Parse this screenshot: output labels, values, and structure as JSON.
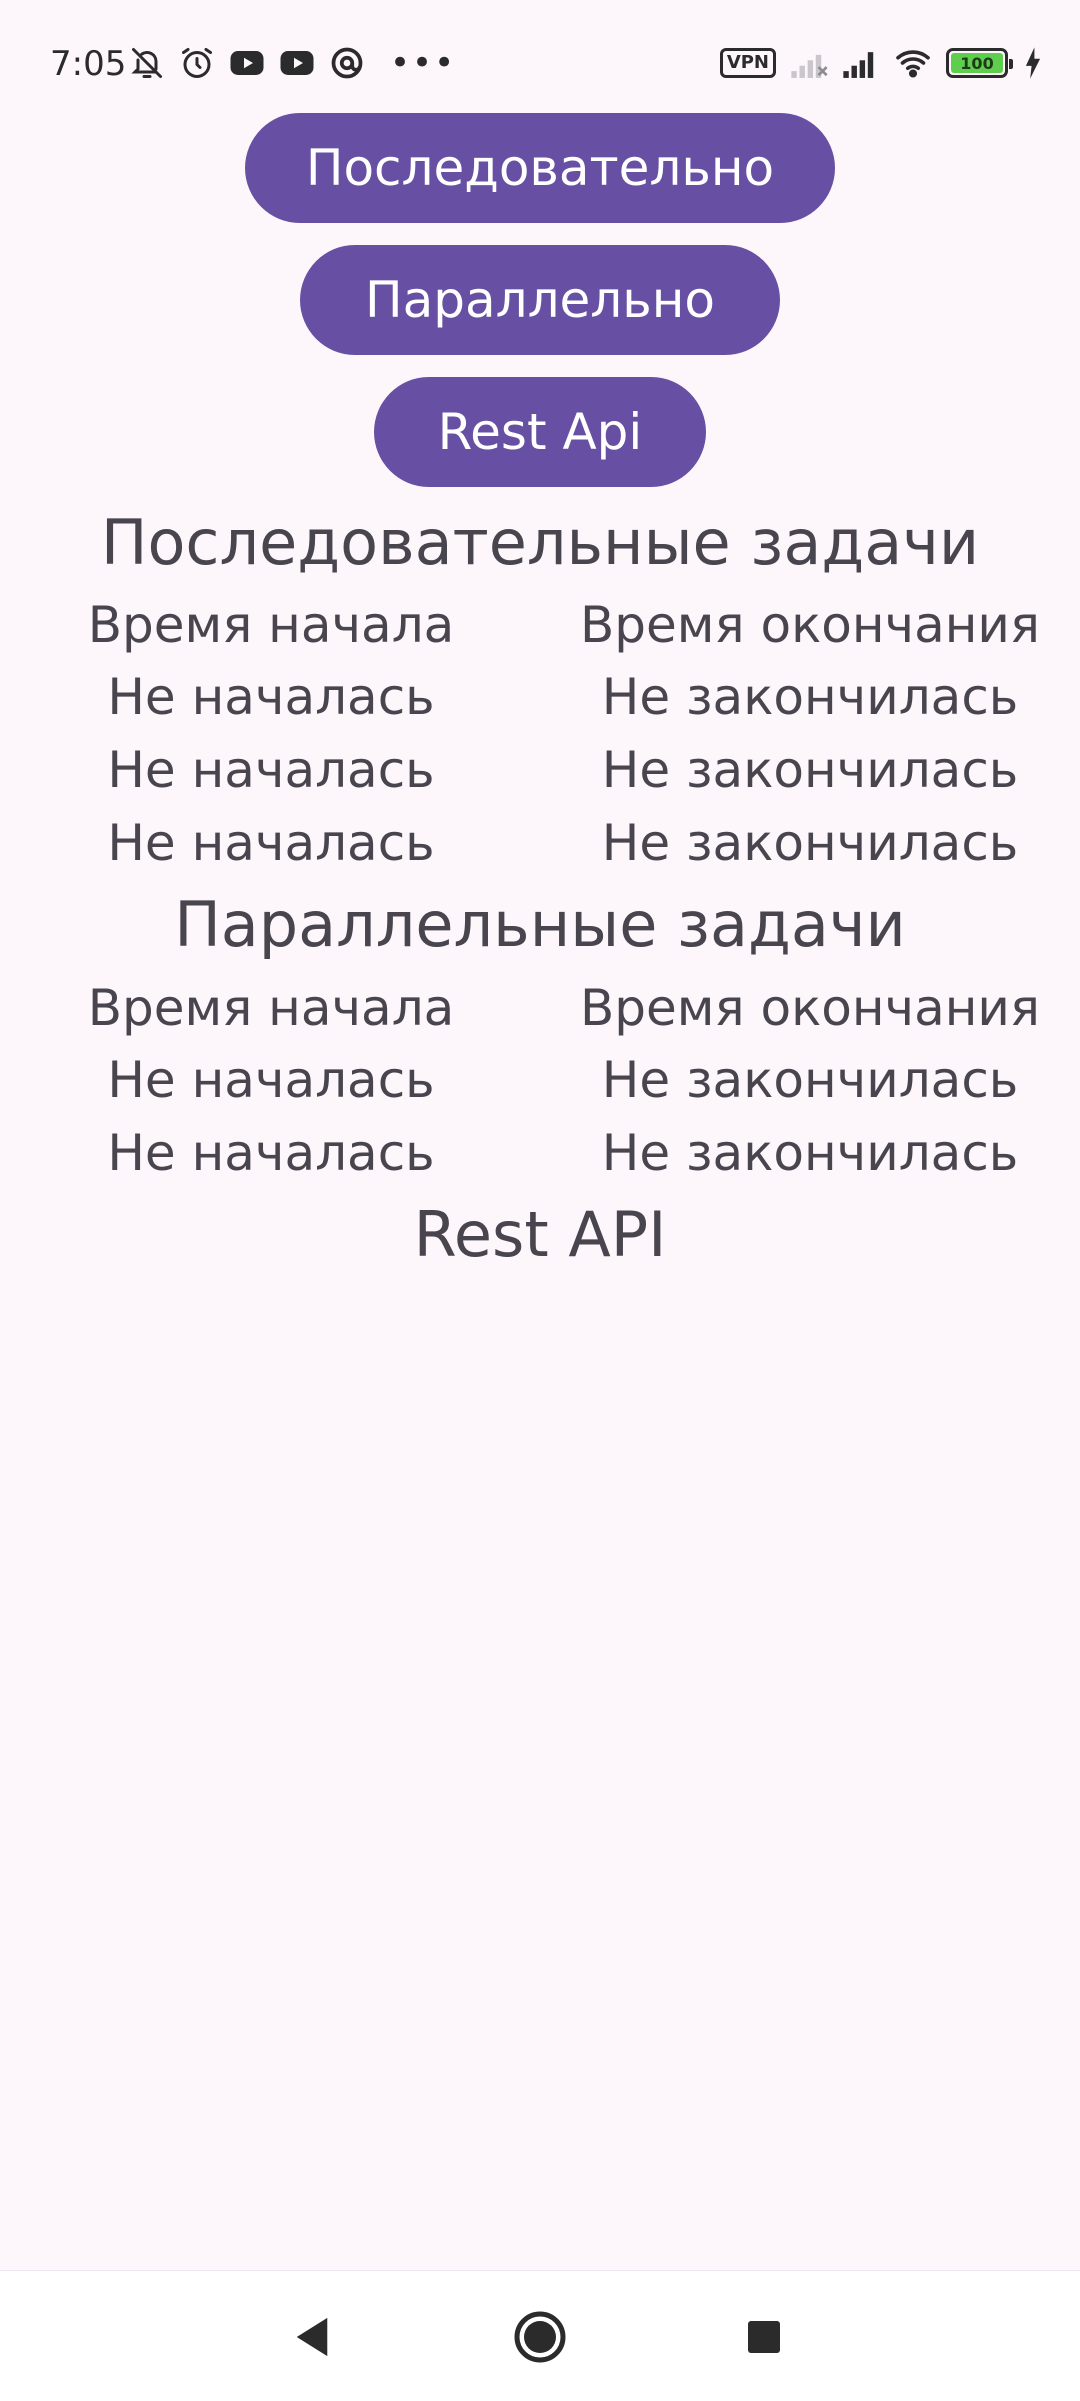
{
  "status_bar": {
    "time": "7:05",
    "more_indicator": "•••",
    "vpn_label": "VPN",
    "battery_level": "100",
    "icons_left": [
      "bell-off-icon",
      "alarm-icon",
      "youtube-icon",
      "youtube-icon",
      "at-sign-icon",
      "more-icon"
    ],
    "icons_right": [
      "vpn-icon",
      "signal-off-icon",
      "signal-icon",
      "wifi-icon",
      "battery-icon",
      "charging-icon"
    ]
  },
  "buttons": {
    "sequential_label": "Последовательно",
    "parallel_label": "Параллельно",
    "rest_api_label": "Rest Api"
  },
  "sequential": {
    "title": "Последовательные задачи",
    "header_start": "Время начала",
    "header_end": "Время окончания",
    "rows": [
      {
        "start": "Не началась",
        "end": "Не закончилась"
      },
      {
        "start": "Не началась",
        "end": "Не закончилась"
      },
      {
        "start": "Не началась",
        "end": "Не закончилась"
      }
    ]
  },
  "parallel": {
    "title": "Параллельные задачи",
    "header_start": "Время начала",
    "header_end": "Время окончания",
    "rows": [
      {
        "start": "Не началась",
        "end": "Не закончилась"
      },
      {
        "start": "Не началась",
        "end": "Не закончилась"
      }
    ]
  },
  "rest_api": {
    "title": "Rest API"
  },
  "colors": {
    "background": "#fdf7fc",
    "button": "#6750a4",
    "button_text": "#ffffff",
    "text": "#49454f"
  },
  "navigation": {
    "icons": [
      "back-icon",
      "home-icon",
      "recents-icon"
    ]
  }
}
